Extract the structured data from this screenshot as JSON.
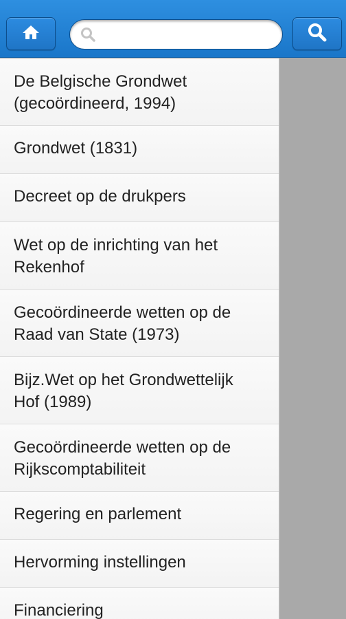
{
  "header": {
    "home_icon": "home-icon",
    "search_placeholder": "",
    "search_value": "",
    "search_icon": "search-icon"
  },
  "list": {
    "items": [
      {
        "label": "De Belgische Grondwet\n(gecoördineerd, 1994)",
        "lines": 2
      },
      {
        "label": "Grondwet (1831)",
        "lines": 1
      },
      {
        "label": "Decreet op de drukpers",
        "lines": 1
      },
      {
        "label": "Wet op de inrichting van het\nRekenhof",
        "lines": 2
      },
      {
        "label": "Gecoördineerde wetten op de\nRaad van State (1973)",
        "lines": 2
      },
      {
        "label": "Bijz.Wet op het Grondwettelijk\nHof (1989)",
        "lines": 2
      },
      {
        "label": "Gecoördineerde wetten op de\nRijkscomptabiliteit",
        "lines": 2
      },
      {
        "label": "Regering en parlement",
        "lines": 1
      },
      {
        "label": "Hervorming instellingen",
        "lines": 1
      },
      {
        "label": "Financiering",
        "lines": 1
      }
    ]
  },
  "colors": {
    "header": "#1a76c9",
    "list_bg": "#f6f6f6",
    "overlay": "#a9a9a9"
  }
}
